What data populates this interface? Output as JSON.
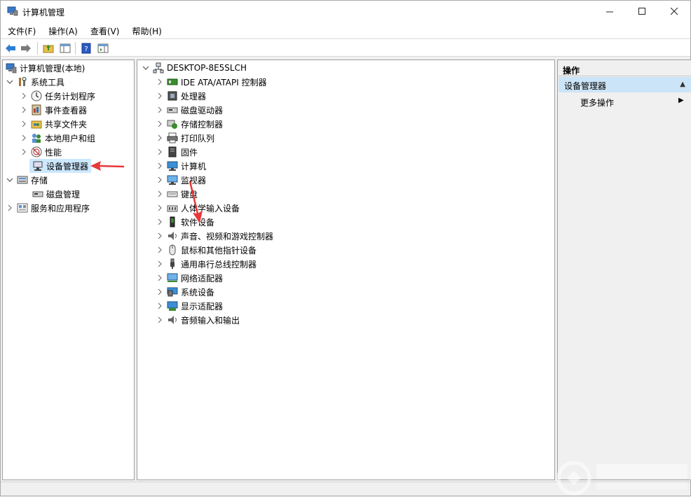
{
  "window": {
    "title": "计算机管理",
    "controls": {
      "minimize": "—",
      "maximize": "☐",
      "close": "✕"
    }
  },
  "menu": [
    "文件(F)",
    "操作(A)",
    "查看(V)",
    "帮助(H)"
  ],
  "left_tree": {
    "root": "计算机管理(本地)",
    "system_tools": "系统工具",
    "task_scheduler": "任务计划程序",
    "event_viewer": "事件查看器",
    "shared_folders": "共享文件夹",
    "local_users": "本地用户和组",
    "performance": "性能",
    "device_manager": "设备管理器",
    "storage": "存储",
    "disk_management": "磁盘管理",
    "services_apps": "服务和应用程序"
  },
  "center": {
    "computer": "DESKTOP-8E5SLCH",
    "devices": [
      "IDE ATA/ATAPI 控制器",
      "处理器",
      "磁盘驱动器",
      "存储控制器",
      "打印队列",
      "固件",
      "计算机",
      "监视器",
      "键盘",
      "人体学输入设备",
      "软件设备",
      "声音、视频和游戏控制器",
      "鼠标和其他指针设备",
      "通用串行总线控制器",
      "网络适配器",
      "系统设备",
      "显示适配器",
      "音频输入和输出"
    ]
  },
  "actions": {
    "header": "操作",
    "group": "设备管理器",
    "more": "更多操作"
  },
  "colors": {
    "selection": "#cce8ff",
    "action_group": "#cce4f7",
    "arrow": "#e8383b"
  }
}
